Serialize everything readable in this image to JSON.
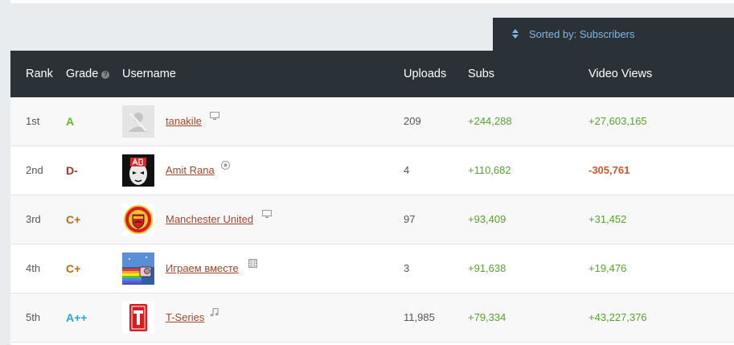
{
  "sort": {
    "label": "Sorted by: Subscribers"
  },
  "colors": {
    "positive": "#55a32c",
    "negative": "#c85a2b",
    "link": "#a0472e",
    "header_bg": "#2b3237"
  },
  "table": {
    "headers": {
      "rank": "Rank",
      "grade": "Grade",
      "username": "Username",
      "uploads": "Uploads",
      "subs": "Subs",
      "views": "Video Views"
    },
    "rows": [
      {
        "rank": "1st",
        "grade": "A",
        "grade_color": "#66b832",
        "avatar": "default-avatar",
        "username": "tanakile",
        "type_icon": "monitor-icon",
        "uploads": "209",
        "subs": "+244,288",
        "views": "+27,603,165",
        "views_negative": false
      },
      {
        "rank": "2nd",
        "grade": "D-",
        "grade_color": "#a8342a",
        "avatar": "ab-mask-avatar",
        "username": "Amit Rana",
        "type_icon": "soccer-ball-icon",
        "uploads": "4",
        "subs": "+110,682",
        "views": "-305,761",
        "views_negative": true
      },
      {
        "rank": "3rd",
        "grade": "C+",
        "grade_color": "#b36f16",
        "avatar": "manchester-united-crest",
        "username": "Manchester United",
        "type_icon": "monitor-icon",
        "uploads": "97",
        "subs": "+93,409",
        "views": "+31,452",
        "views_negative": false
      },
      {
        "rank": "4th",
        "grade": "C+",
        "grade_color": "#b36f16",
        "avatar": "nyan-cat-avatar",
        "username": "Играем вместе",
        "type_icon": "film-icon",
        "uploads": "3",
        "subs": "+91,638",
        "views": "+19,476",
        "views_negative": false
      },
      {
        "rank": "5th",
        "grade": "A++",
        "grade_color": "#2aa7d8",
        "avatar": "t-series-logo",
        "username": "T-Series",
        "type_icon": "music-note-icon",
        "uploads": "11,985",
        "subs": "+79,334",
        "views": "+43,227,376",
        "views_negative": false
      }
    ]
  }
}
